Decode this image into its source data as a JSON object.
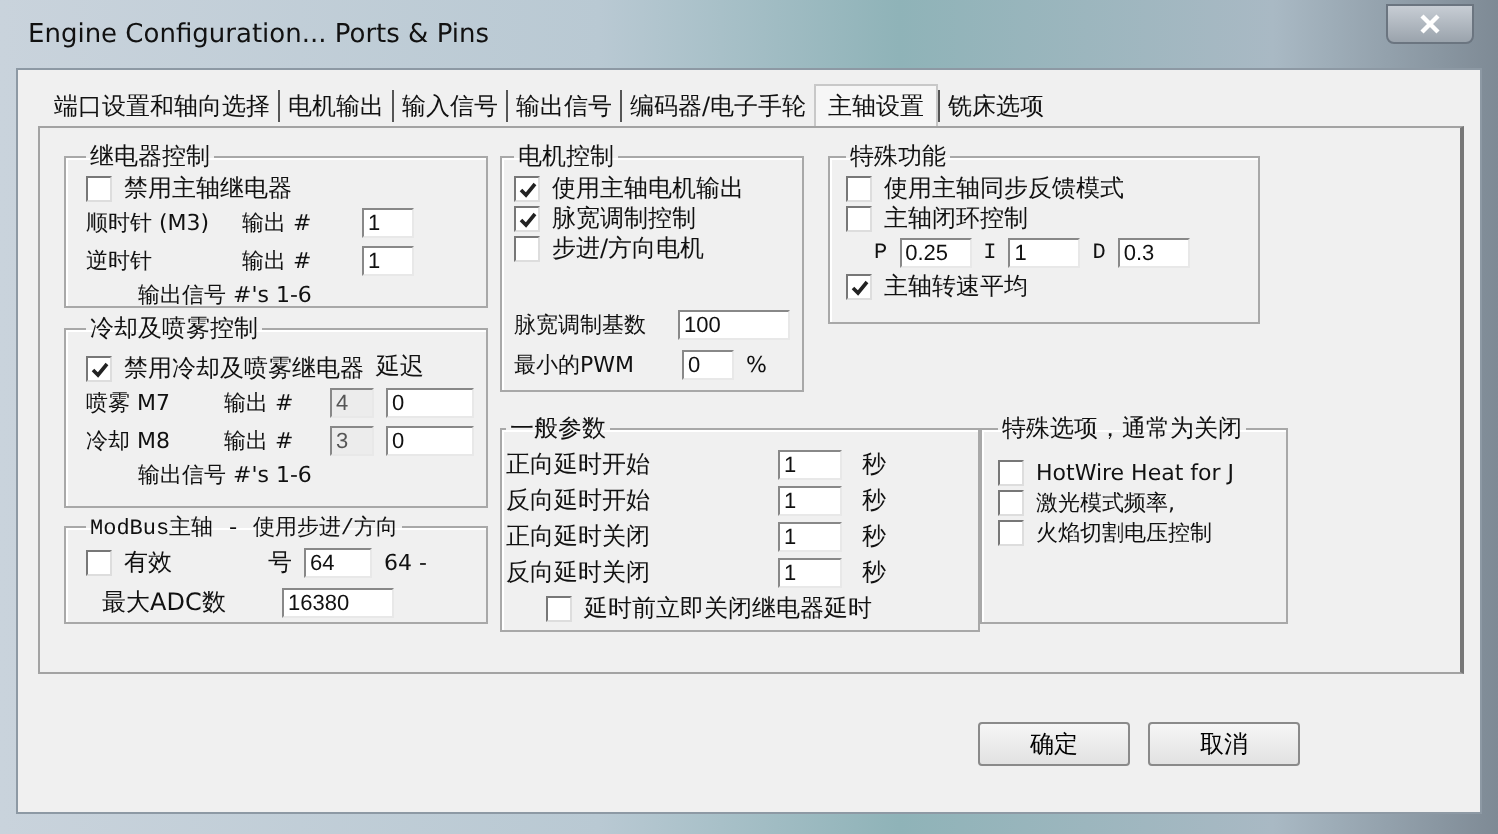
{
  "window": {
    "title": "Engine Configuration... Ports & Pins"
  },
  "tabs": [
    {
      "label": "端口设置和轴向选择",
      "selected": false
    },
    {
      "label": "电机输出",
      "selected": false
    },
    {
      "label": "输入信号",
      "selected": false
    },
    {
      "label": "输出信号",
      "selected": false
    },
    {
      "label": "编码器/电子手轮",
      "selected": false
    },
    {
      "label": "主轴设置",
      "selected": true
    },
    {
      "label": "铣床选项",
      "selected": false
    }
  ],
  "relay_control": {
    "title": "继电器控制",
    "disable_relay": {
      "label": "禁用主轴继电器",
      "checked": false
    },
    "rows": [
      {
        "label": "顺时针 (M3)",
        "output_label": "输出 #",
        "value": "1"
      },
      {
        "label": "逆时针",
        "output_label": "输出 #",
        "value": "1"
      }
    ],
    "note": "输出信号 #'s 1-6"
  },
  "coolant_control": {
    "title": "冷却及喷雾控制",
    "disable_relay": {
      "label": "禁用冷却及喷雾继电器",
      "checked": true
    },
    "delay_label": "延迟",
    "rows": [
      {
        "label": "喷雾 M7",
        "output_label": "输出 #",
        "value": "4",
        "disabled": true,
        "delay": "0"
      },
      {
        "label": "冷却 M8",
        "output_label": "输出 #",
        "value": "3",
        "disabled": true,
        "delay": "0"
      }
    ],
    "note": "输出信号 #'s 1-6"
  },
  "modbus": {
    "title": "ModBus主轴 - 使用步进/方向",
    "enabled": {
      "label": "有效",
      "checked": false
    },
    "number_label": "号",
    "number": "64",
    "number_suffix": "64 -",
    "max_adc_label": "最大ADC数",
    "max_adc": "16380"
  },
  "motor_control": {
    "title": "电机控制",
    "options": [
      {
        "label": "使用主轴电机输出",
        "checked": true
      },
      {
        "label": "脉宽调制控制",
        "checked": true
      },
      {
        "label": "步进/方向电机",
        "checked": false
      }
    ],
    "pwm_base_label": "脉宽调制基数",
    "pwm_base": "100",
    "min_pwm_label": "最小的PWM",
    "min_pwm": "0",
    "min_pwm_unit": "%"
  },
  "special_functions": {
    "title": "特殊功能",
    "options": [
      {
        "label": "使用主轴同步反馈模式",
        "checked": false
      },
      {
        "label": "主轴闭环控制",
        "checked": false
      }
    ],
    "pid": [
      {
        "label": "P",
        "value": "0.25"
      },
      {
        "label": "I",
        "value": "1"
      },
      {
        "label": "D",
        "value": "0.3"
      }
    ],
    "speed_averaging": {
      "label": "主轴转速平均",
      "checked": true
    }
  },
  "general_params": {
    "title": "一般参数",
    "delays": [
      {
        "label": "正向延时开始",
        "value": "1",
        "unit": "秒"
      },
      {
        "label": "反向延时开始",
        "value": "1",
        "unit": "秒"
      },
      {
        "label": "正向延时关闭",
        "value": "1",
        "unit": "秒"
      },
      {
        "label": "反向延时关闭",
        "value": "1",
        "unit": "秒"
      }
    ],
    "immediate_off": {
      "label": "延时前立即关闭继电器延时",
      "checked": false
    }
  },
  "special_options": {
    "title": "特殊选项，通常为关闭",
    "options": [
      {
        "label": "HotWire Heat for J",
        "checked": false
      },
      {
        "label": "激光模式频率,",
        "checked": false
      },
      {
        "label": "火焰切割电压控制",
        "checked": false
      }
    ]
  },
  "buttons": [
    {
      "label": "确定"
    },
    {
      "label": "取消"
    }
  ]
}
